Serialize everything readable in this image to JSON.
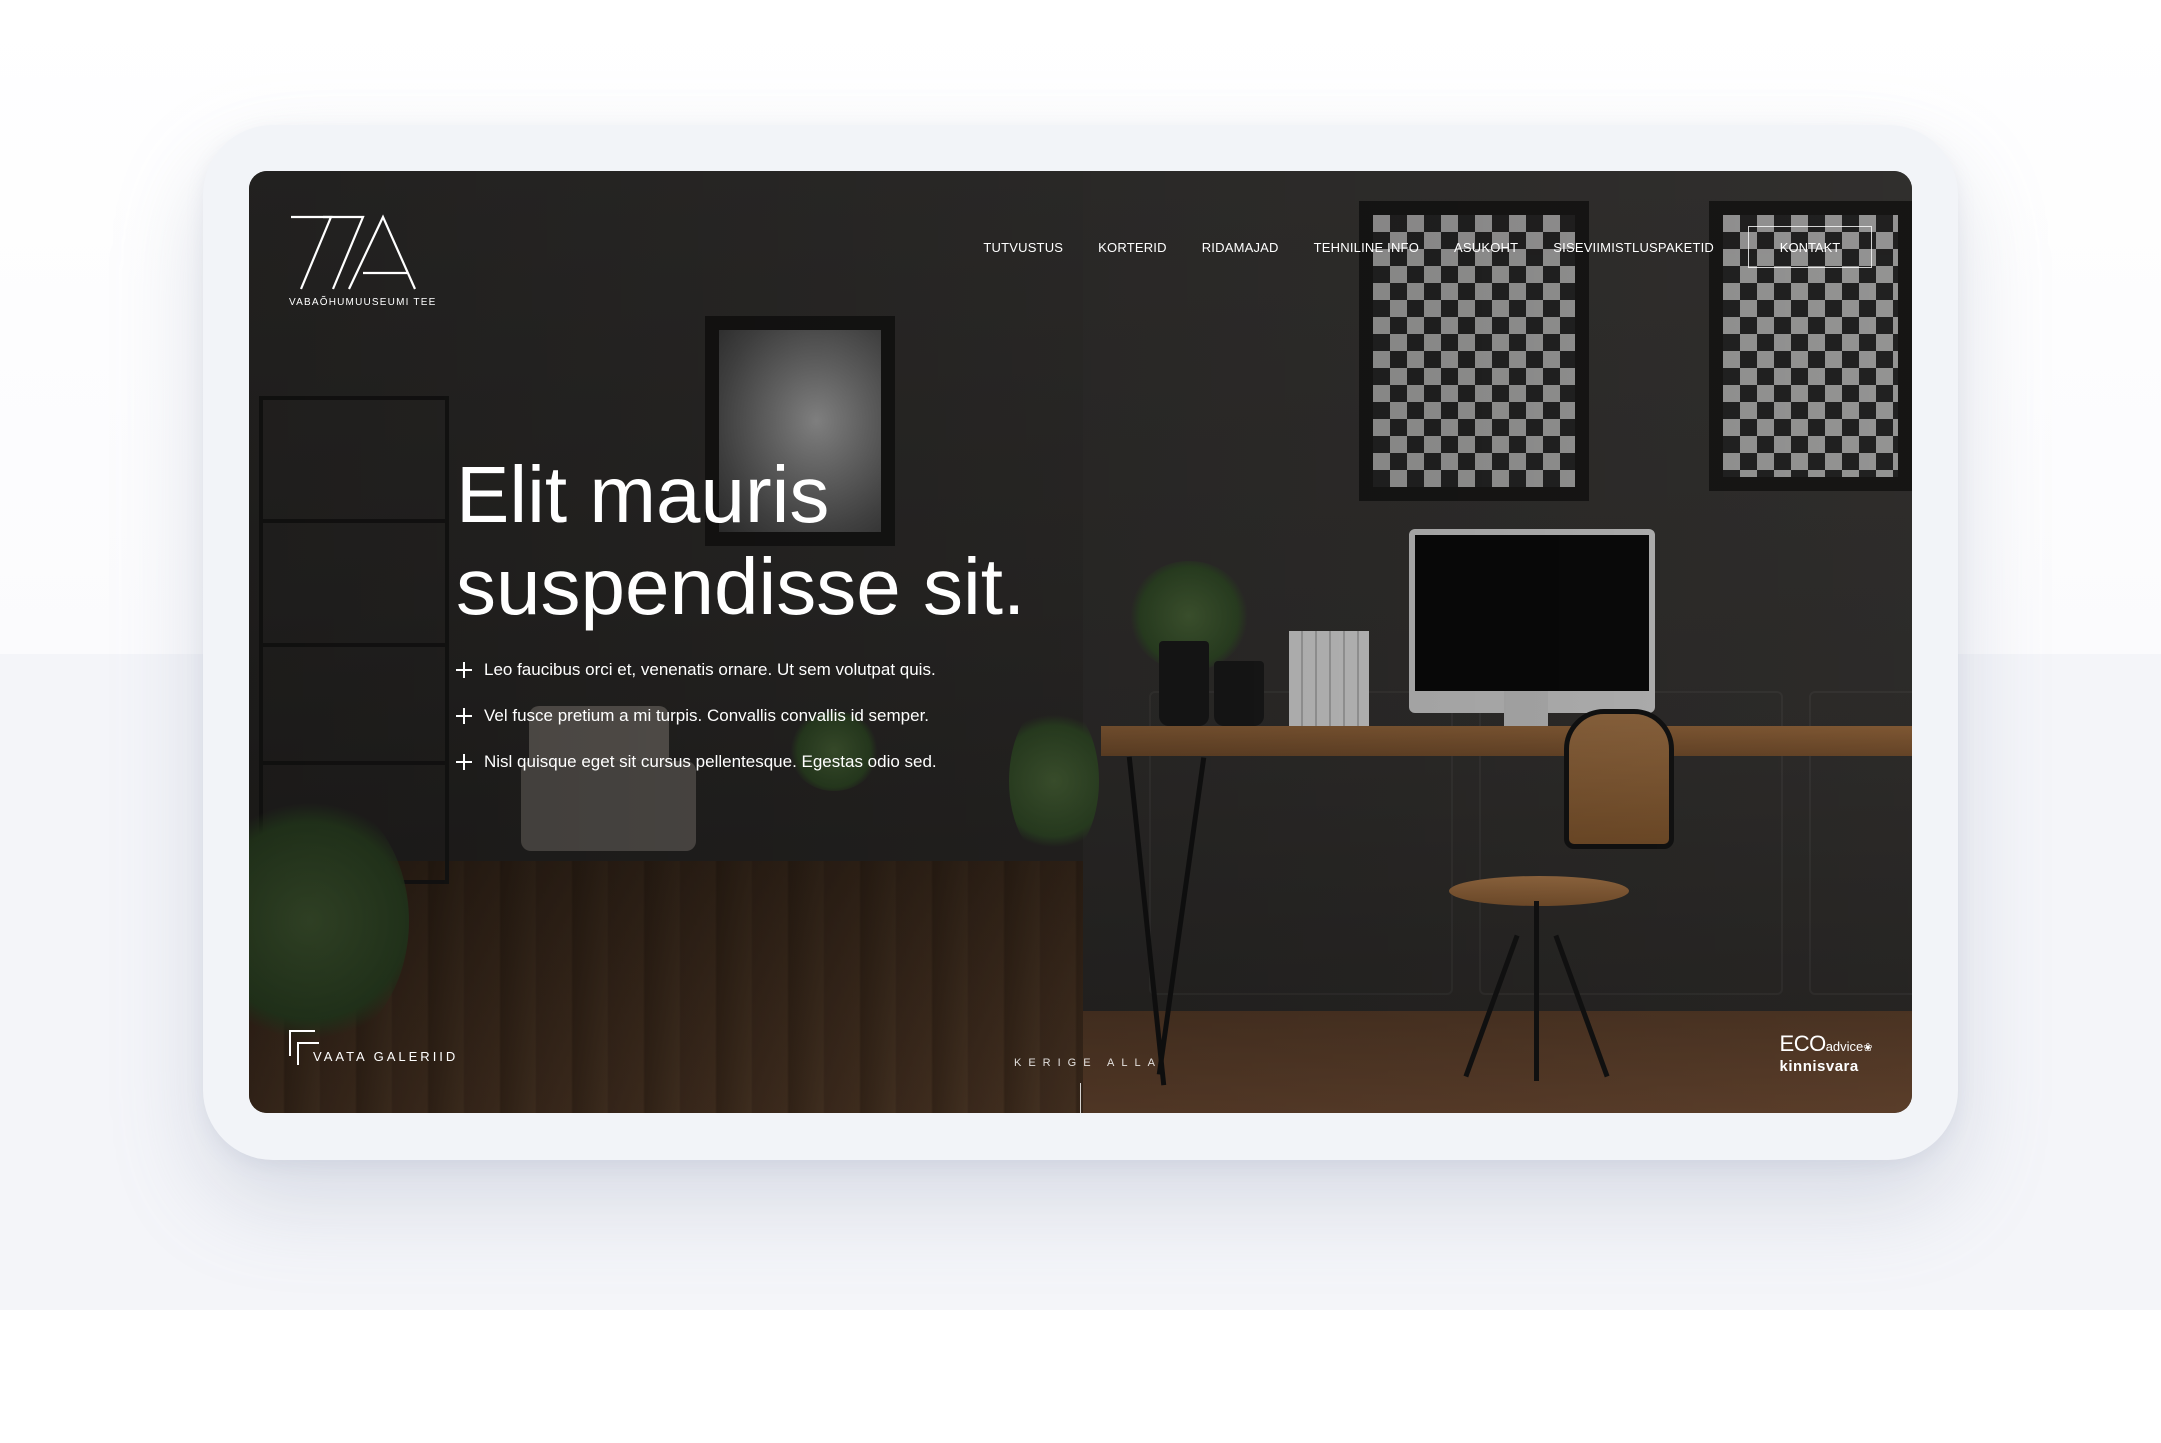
{
  "logo": {
    "subtitle": "VABAÕHUMUUSEUMI TEE"
  },
  "nav": {
    "items": [
      {
        "label": "TUTVUSTUS"
      },
      {
        "label": "KORTERID"
      },
      {
        "label": "RIDAMAJAD"
      },
      {
        "label": "TEHNILINE INFO"
      },
      {
        "label": "ASUKOHT"
      },
      {
        "label": "SISEVIIMISTLUSPAKETID"
      }
    ],
    "cta_label": "KONTAKT"
  },
  "hero": {
    "title_line1": "Elit mauris",
    "title_line2": "suspendisse sit.",
    "bullets": [
      {
        "text": "Leo faucibus orci et, venenatis ornare. Ut sem volutpat quis."
      },
      {
        "text": "Vel fusce pretium a mi turpis. Convallis convallis id semper."
      },
      {
        "text": "Nisl quisque eget sit cursus pellentesque. Egestas odio sed."
      }
    ]
  },
  "footer": {
    "gallery_label": "VAATA GALERIID",
    "scroll_label": "KERIGE ALLA",
    "brand_top": "ECO",
    "brand_top_small": "advice",
    "brand_bottom": "kinnisvara"
  },
  "colors": {
    "text": "#ffffff",
    "page_band": "#f4f5f9",
    "device_frame": "#f2f4f8"
  },
  "icons": [
    "77a-logo-icon",
    "plus-icon",
    "gallery-corner-icon",
    "leaf-icon"
  ]
}
